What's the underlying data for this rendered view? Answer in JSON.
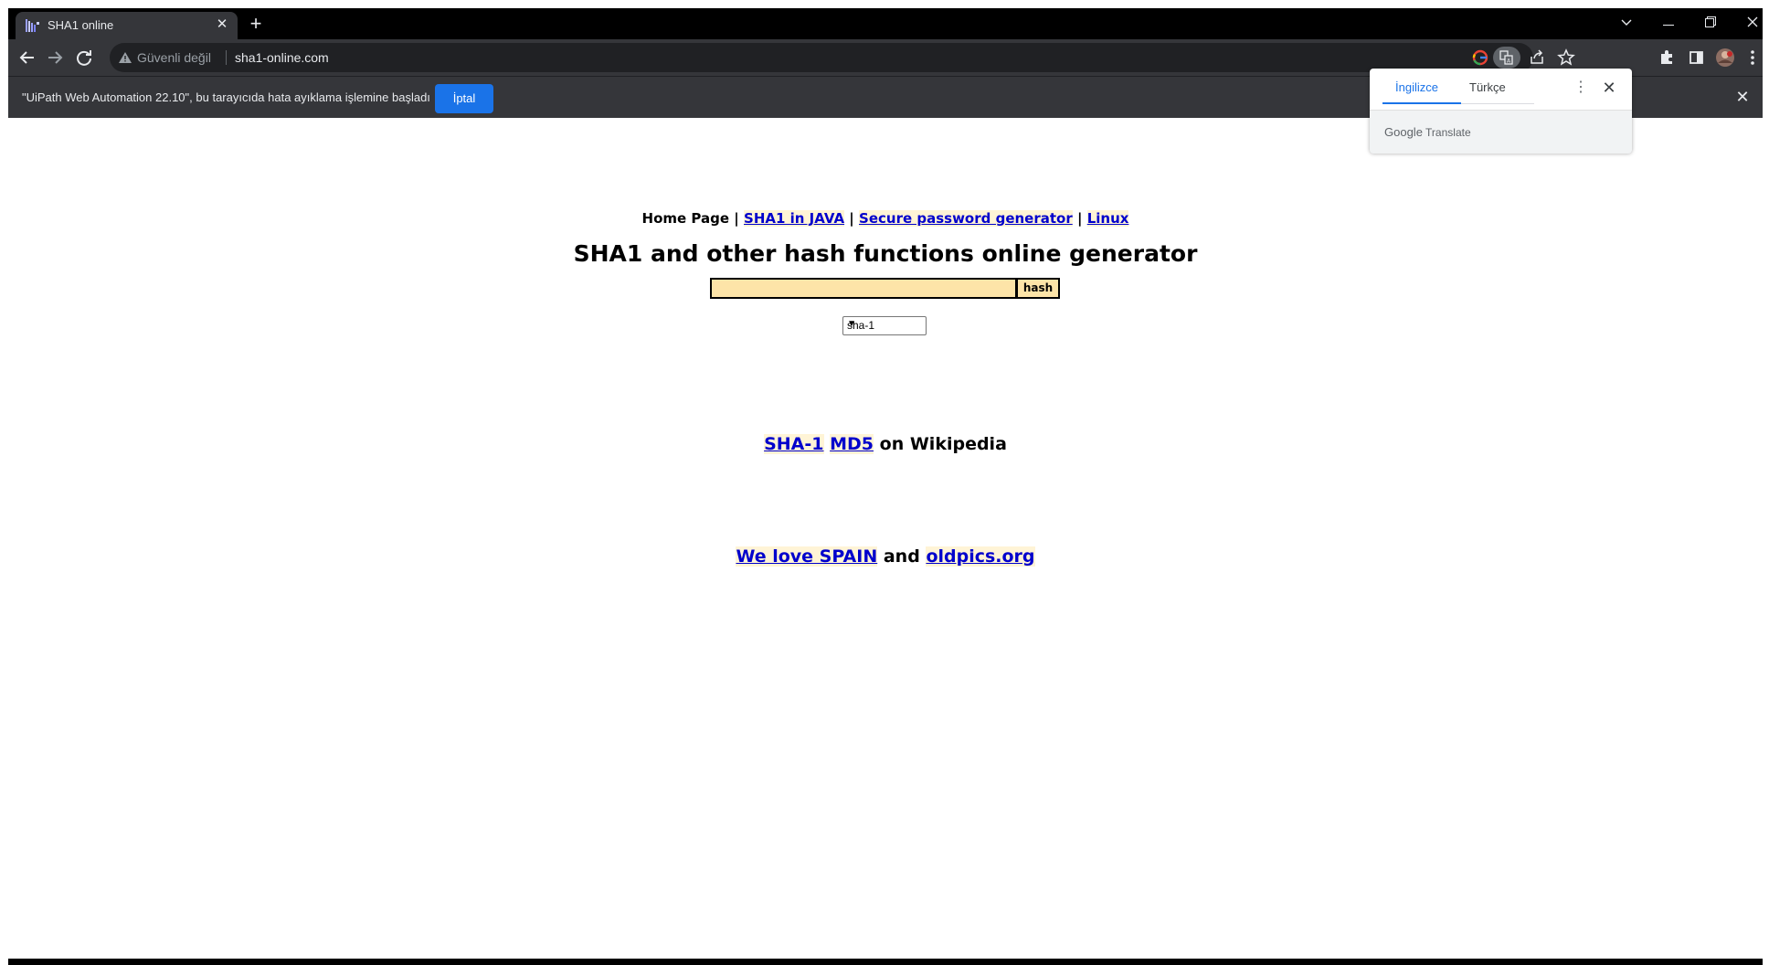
{
  "browser": {
    "tab_title": "SHA1 online",
    "security_label": "Güvenli değil",
    "url": "sha1-online.com"
  },
  "infobar": {
    "message": "\"UiPath Web Automation 22.10\", bu tarayıcıda hata ayıklama işlemine başladı",
    "cancel_label": "İptal"
  },
  "translate": {
    "source_lang": "İngilizce",
    "target_lang": "Türkçe",
    "brand_google": "Google",
    "brand_translate": "Translate"
  },
  "page": {
    "nav": {
      "home": "Home Page",
      "sep": "|",
      "sha1_java": "SHA1 in JAVA",
      "password_gen": "Secure password generator",
      "linux": "Linux"
    },
    "title": "SHA1 and other hash functions online generator",
    "hash_button": "hash",
    "hash_input_value": "",
    "algorithm_selected": "sha-1",
    "wiki": {
      "sha1": "SHA-1",
      "md5": "MD5",
      "suffix": "on Wikipedia"
    },
    "love": {
      "spain": "We love SPAIN",
      "and": "and",
      "oldpics": "oldpics.org"
    }
  },
  "colors": {
    "link": "#0000cc",
    "input_bg": "#fde4a8",
    "accent": "#1a73e8"
  }
}
